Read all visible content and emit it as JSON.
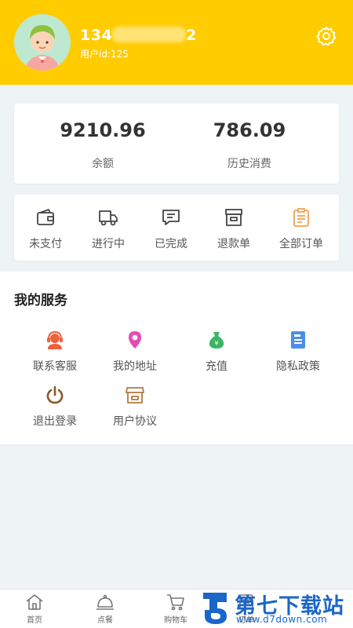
{
  "header": {
    "phone_start": "134",
    "phone_end": "2",
    "user_id": "用户id:125"
  },
  "stats": [
    {
      "value": "9210.96",
      "label": "余额"
    },
    {
      "value": "786.09",
      "label": "历史消费"
    }
  ],
  "orders": [
    {
      "label": "未支付",
      "icon": "wallet-icon"
    },
    {
      "label": "进行中",
      "icon": "truck-icon"
    },
    {
      "label": "已完成",
      "icon": "message-icon"
    },
    {
      "label": "退款单",
      "icon": "box-icon"
    },
    {
      "label": "全部订单",
      "icon": "clipboard-icon"
    }
  ],
  "services": {
    "title": "我的服务",
    "items": [
      {
        "label": "联系客服",
        "icon": "customer-service-icon",
        "color": "#f0603c"
      },
      {
        "label": "我的地址",
        "icon": "location-pin-icon",
        "color": "#e64bb4"
      },
      {
        "label": "充值",
        "icon": "money-bag-icon",
        "color": "#3cb464"
      },
      {
        "label": "隐私政策",
        "icon": "document-icon",
        "color": "#4a8fe6"
      },
      {
        "label": "退出登录",
        "icon": "power-icon",
        "color": "#8b5a2b"
      },
      {
        "label": "用户协议",
        "icon": "store-icon",
        "color": "#b07a3c"
      }
    ]
  },
  "tabbar": [
    {
      "label": "首页",
      "icon": "home-icon"
    },
    {
      "label": "点餐",
      "icon": "cloche-icon"
    },
    {
      "label": "购物车",
      "icon": "cart-icon"
    },
    {
      "label": "订单",
      "icon": "order-icon"
    }
  ],
  "watermark": {
    "title": "第七下载站",
    "url": "www.d7down.com"
  },
  "colors": {
    "accent": "#ffcc00",
    "background": "#eef3f6"
  }
}
